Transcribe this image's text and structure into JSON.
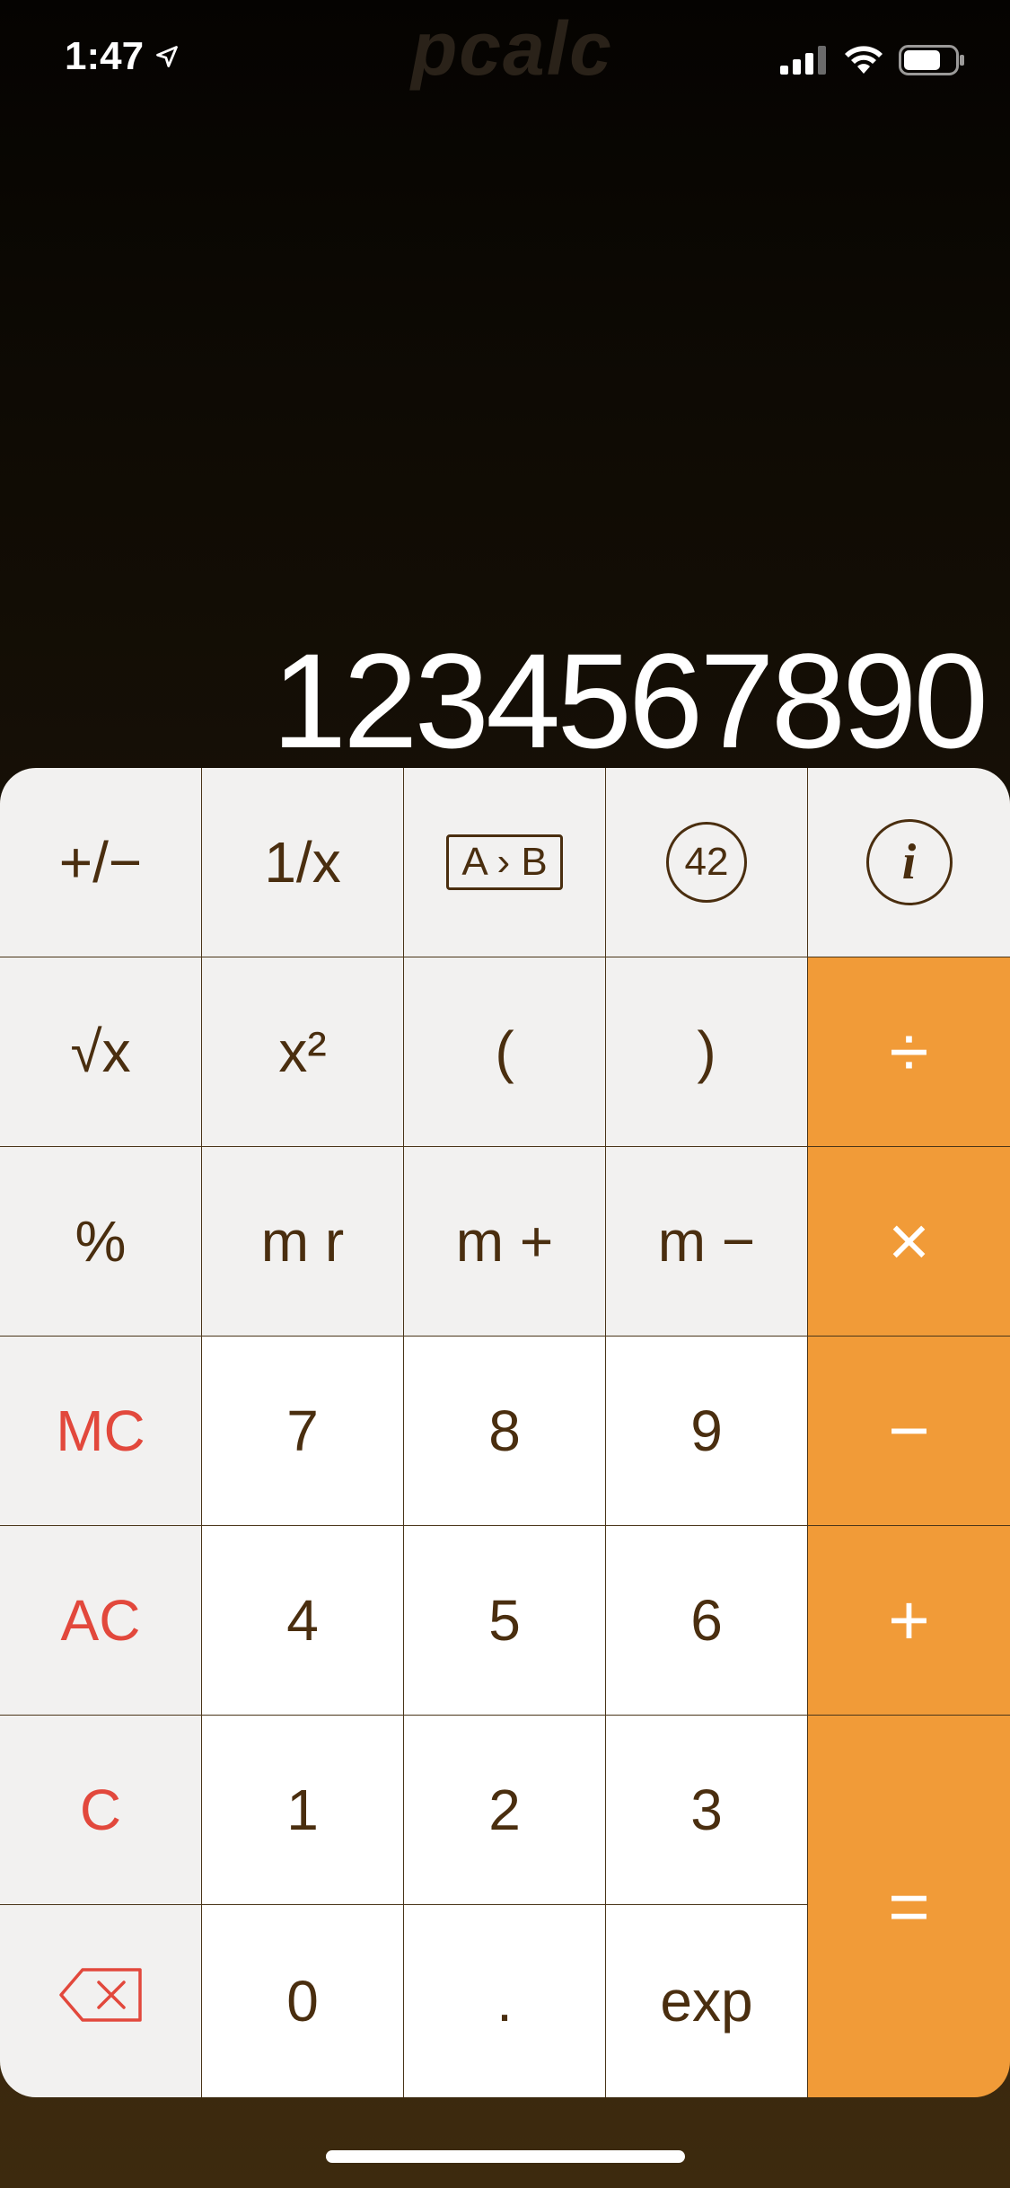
{
  "status_bar": {
    "time": "1:47",
    "icons": [
      "location-arrow-icon",
      "cellular-signal-icon",
      "wifi-icon",
      "battery-icon"
    ]
  },
  "brand": "pcalc",
  "display": {
    "value": "1234567890"
  },
  "keys": {
    "sign": "+/−",
    "reciprocal": "1/x",
    "a_to_b": "A › B",
    "answer_42": "42",
    "info": "i",
    "sqrt": "√x",
    "square": "x²",
    "open_paren": "(",
    "close_paren": ")",
    "divide": "÷",
    "percent": "%",
    "mem_recall": "m r",
    "mem_plus": "m +",
    "mem_minus": "m −",
    "multiply": "×",
    "mem_clear": "MC",
    "seven": "7",
    "eight": "8",
    "nine": "9",
    "subtract": "−",
    "all_clear": "AC",
    "four": "4",
    "five": "5",
    "six": "6",
    "add": "+",
    "clear": "C",
    "one": "1",
    "two": "2",
    "three": "3",
    "equals": "=",
    "backspace": "backspace-icon",
    "zero": "0",
    "decimal": ".",
    "exp": "exp"
  },
  "colors": {
    "operator": "#f19b38",
    "function_key": "#f2f1f0",
    "number_key": "#ffffff",
    "key_text": "#4a2e0f",
    "clear_text": "#e2483c"
  }
}
